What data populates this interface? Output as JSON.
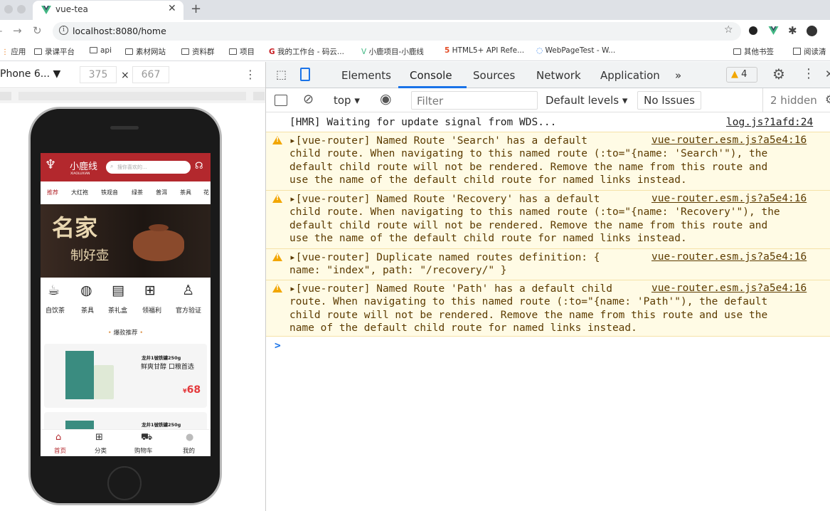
{
  "browser": {
    "tab_title": "vue-tea",
    "url": "localhost:8080/home",
    "bookmarks": [
      "应用",
      "录课平台",
      "api",
      "素材网站",
      "资料群",
      "项目",
      "我的工作台 - 码云...",
      "小鹿项目-小鹿线",
      "HTML5+ API Refe...",
      "WebPageTest - W...",
      "其他书签",
      "阅读清"
    ]
  },
  "device_toolbar": {
    "device": "Phone 6...",
    "width": "375",
    "x": "×",
    "height": "667"
  },
  "app": {
    "brand": "小鹿线",
    "brand_sub": "XIAOLUXIAN",
    "search_placeholder": "搜你喜欢的...",
    "nav": [
      "推荐",
      "大红袍",
      "铁观音",
      "绿茶",
      "普洱",
      "茶具",
      "花"
    ],
    "banner_title": "名家",
    "banner_sub": "制好壶",
    "categories": [
      "自饮茶",
      "茶具",
      "茶礼盒",
      "领福利",
      "官方验证"
    ],
    "section_title": "爆款推荐",
    "products": [
      {
        "name": "龙井1號铁罐250g",
        "desc": "鲜爽甘醇 口粮首选",
        "price": "68",
        "currency": "¥"
      },
      {
        "name": "龙井1號铁罐250g",
        "desc": "",
        "price": "",
        "currency": ""
      }
    ],
    "tabbar": [
      "首页",
      "分类",
      "购物车",
      "我的"
    ]
  },
  "devtools": {
    "tabs": [
      "Elements",
      "Console",
      "Sources",
      "Network",
      "Application"
    ],
    "more": "»",
    "warn_count": "4",
    "context": "top",
    "filter_placeholder": "Filter",
    "levels": "Default levels",
    "issues": "No Issues",
    "hidden": "2 hidden",
    "messages": [
      {
        "type": "log",
        "text": "[HMR] Waiting for update signal from WDS...",
        "source": "log.js?1afd:24"
      },
      {
        "type": "warning",
        "text": "▸[vue-router] Named Route 'Search' has a default\nchild route. When navigating to this named route (:to=\"{name: 'Search'\"), the\ndefault child route will not be rendered. Remove the name from this route and\nuse the name of the default child route for named links instead.",
        "source": "vue-router.esm.js?a5e4:16"
      },
      {
        "type": "warning",
        "text": "▸[vue-router] Named Route 'Recovery' has a default\nchild route. When navigating to this named route (:to=\"{name: 'Recovery'\"), the\ndefault child route will not be rendered. Remove the name from this route and\nuse the name of the default child route for named links instead.",
        "source": "vue-router.esm.js?a5e4:16"
      },
      {
        "type": "warning",
        "text": "▸[vue-router] Duplicate named routes definition: {\nname: \"index\", path: \"/recovery/\" }",
        "source": "vue-router.esm.js?a5e4:16"
      },
      {
        "type": "warning",
        "text": "▸[vue-router] Named Route 'Path' has a default child\nroute. When navigating to this named route (:to=\"{name: 'Path'\"), the default\nchild route will not be rendered. Remove the name from this route and use the\nname of the default child route for named links instead.",
        "source": "vue-router.esm.js?a5e4:16"
      }
    ],
    "prompt": ">"
  },
  "colors": {
    "brand_red": "#b3282d",
    "warning_bg": "#fffbe5",
    "accent_blue": "#1a73e8"
  }
}
